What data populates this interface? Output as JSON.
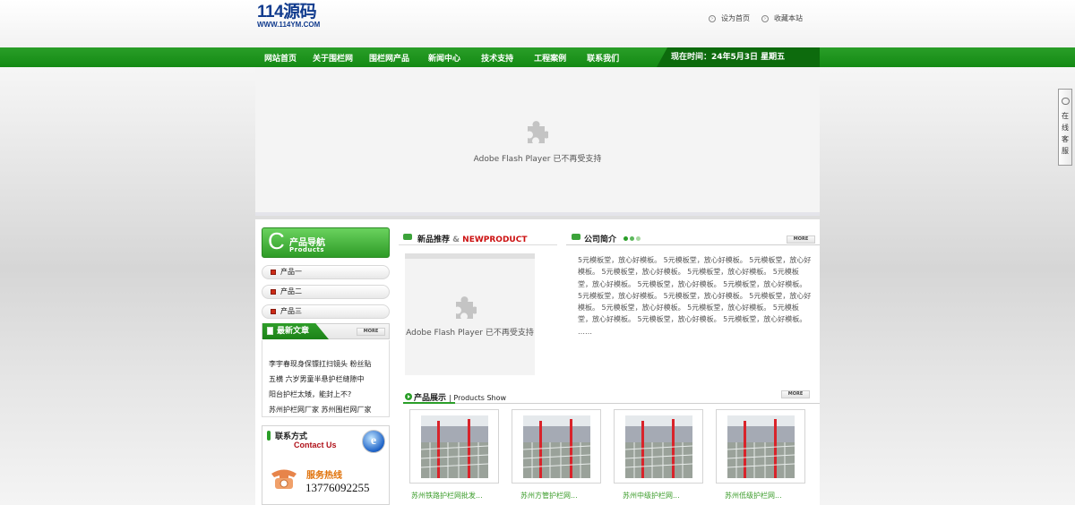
{
  "header": {
    "logo_main": "114源码",
    "logo_sub": "WWW.114YM.COM",
    "set_home": "设为首页",
    "bookmark": "收藏本站"
  },
  "nav": {
    "items": [
      "网站首页",
      "关于围栏网",
      "围栏网产品",
      "新闻中心",
      "技术支持",
      "工程案例",
      "联系我们"
    ],
    "date": "现在时间：24年5月3日 星期五"
  },
  "banner": {
    "flash_message": "Adobe Flash Player 已不再受支持"
  },
  "sidebar": {
    "title": "产品导航",
    "title_en": "Products",
    "categories": [
      "产品一",
      "产品二",
      "产品三"
    ]
  },
  "news": {
    "title": "最新文章",
    "more": "MORE",
    "items": [
      "李宇春现身保镖扛扫镜头 粉丝贴",
      "五横   六岁男童半悬护栏缝隙中",
      "阳台护栏太矮，能封上不?",
      "苏州护栏网厂家 苏州围栏网厂家"
    ]
  },
  "contact": {
    "title": "联系方式",
    "title_en": "Contact Us",
    "hotline_label": "服务热线",
    "hotline_number": "13776092255"
  },
  "new_products": {
    "title": "新品推荐",
    "amp": "&",
    "title_en": "NEWPRODUCT",
    "flash_message": "Adobe Flash Player 已不再受支持"
  },
  "company": {
    "title": "公司简介",
    "more": "MORE",
    "text": "5元模板堂，放心好模板。 5元模板堂，放心好模板。 5元模板堂，放心好模板。 5元模板堂，放心好模板。 5元模板堂，放心好模板。 5元模板堂，放心好模板。 5元模板堂，放心好模板。 5元模板堂，放心好模板。 5元模板堂，放心好模板。 5元模板堂，放心好模板。 5元模板堂，放心好模板。 5元模板堂，放心好模板。 5元模板堂，放心好模板。 5元模板堂，放心好模板。 5元模板堂，放心好模板。 5元模板堂，放心好模板。 ……"
  },
  "products_show": {
    "title": "产品展示",
    "title_en": "| Products Show",
    "more": "MORE",
    "items": [
      "苏州铁路护栏网批发...",
      "苏州方管护栏网...",
      "苏州中级护栏网...",
      "苏州低级护栏网..."
    ]
  },
  "service": {
    "label": "在线客服"
  },
  "colors": {
    "nav_green": "#1c8e1a",
    "accent_red": "#cc1111",
    "link_green": "#3b9c2a"
  }
}
